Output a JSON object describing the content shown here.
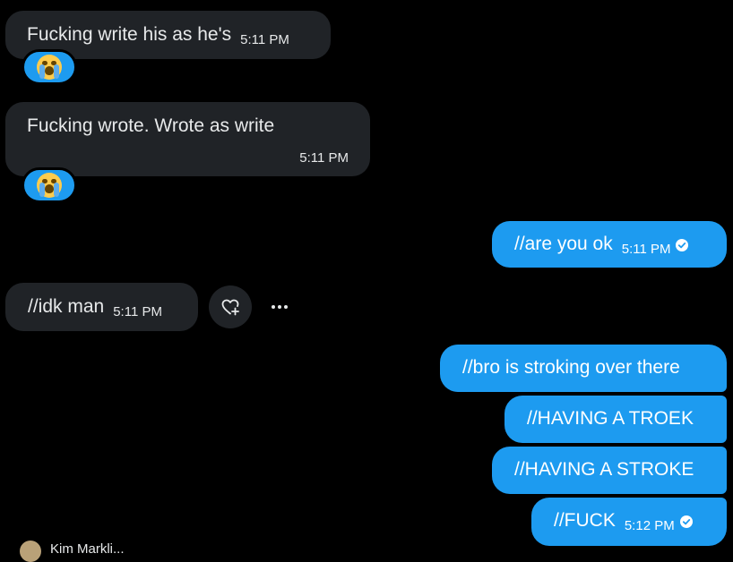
{
  "messages": [
    {
      "text": "Fucking write his as he's",
      "time": "5:11 PM",
      "reaction": "loudly-crying-face"
    },
    {
      "text": "Fucking wrote. Wrote as write",
      "time": "5:11 PM",
      "reaction": "loudly-crying-face"
    },
    {
      "text": "//are you ok",
      "time": "5:11 PM"
    },
    {
      "text": "//idk man",
      "time": "5:11 PM"
    },
    {
      "text": "//bro is stroking over there"
    },
    {
      "text": "//HAVING A TROEK"
    },
    {
      "text": "//HAVING A STROKE"
    },
    {
      "text": "//FUCK",
      "time": "5:12 PM"
    }
  ],
  "footer": {
    "partial_text": "Kim Markli..."
  },
  "colors": {
    "outgoing": "#1d9bf0",
    "incoming": "#202327",
    "background": "#000000"
  }
}
